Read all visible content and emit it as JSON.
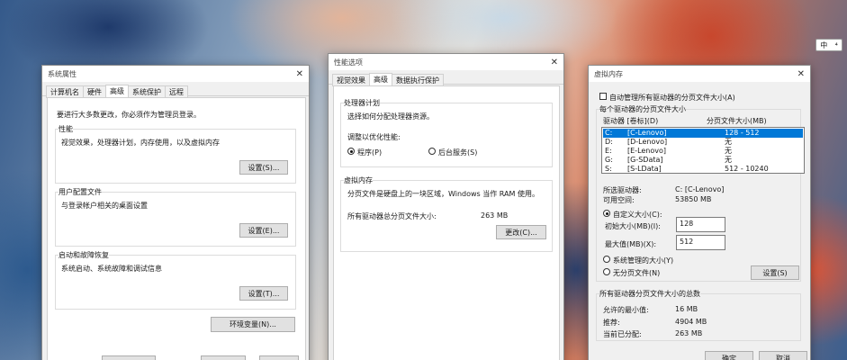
{
  "ime": {
    "mode": "中",
    "extra": "⁴"
  },
  "sys_props": {
    "title": "系统属性",
    "tabs": [
      "计算机名",
      "硬件",
      "高级",
      "系统保护",
      "远程"
    ],
    "admin_note": "要进行大多数更改，你必须作为管理员登录。",
    "perf": {
      "label": "性能",
      "desc": "视觉效果，处理器计划，内存使用，以及虚拟内存",
      "button": "设置(S)..."
    },
    "profile": {
      "label": "用户配置文件",
      "desc": "与登录帐户相关的桌面设置",
      "button": "设置(E)..."
    },
    "startup": {
      "label": "启动和故障恢复",
      "desc": "系统启动、系统故障和调试信息",
      "button": "设置(T)..."
    },
    "env_button": "环境变量(N)..."
  },
  "perf_opts": {
    "title": "性能选项",
    "tabs": [
      "视觉效果",
      "高级",
      "数据执行保护"
    ],
    "sched": {
      "label": "处理器计划",
      "desc": "选择如何分配处理器资源。",
      "adjust": "调整以优化性能:",
      "opt_programs": "程序(P)",
      "opt_services": "后台服务(S)"
    },
    "vmem": {
      "label": "虚拟内存",
      "desc": "分页文件是硬盘上的一块区域，Windows 当作 RAM 使用。",
      "total_label": "所有驱动器总分页文件大小:",
      "total_value": "263 MB",
      "button": "更改(C)..."
    }
  },
  "vm": {
    "title": "虚拟内存",
    "auto_manage": "自动管理所有驱动器的分页文件大小(A)",
    "per_drive_label": "每个驱动器的分页文件大小",
    "col_drive": "驱动器 [卷标](D)",
    "col_size": "分页文件大小(MB)",
    "drives": [
      {
        "letter": "C:",
        "label": "[C-Lenovo]",
        "size": "128 - 512"
      },
      {
        "letter": "D:",
        "label": "[D-Lenovo]",
        "size": "无"
      },
      {
        "letter": "E:",
        "label": "[E-Lenovo]",
        "size": "无"
      },
      {
        "letter": "G:",
        "label": "[G-SData]",
        "size": "无"
      },
      {
        "letter": "S:",
        "label": "[S-LData]",
        "size": "512 - 10240"
      }
    ],
    "selected_drive_label": "所选驱动器:",
    "selected_drive_value": "C:  [C-Lenovo]",
    "free_space_label": "可用空间:",
    "free_space_value": "53850 MB",
    "custom_size": "自定义大小(C):",
    "initial_label": "初始大小(MB)(I):",
    "initial_value": "128",
    "max_label": "最大值(MB)(X):",
    "max_value": "512",
    "system_managed": "系统管理的大小(Y)",
    "no_paging": "无分页文件(N)",
    "set_button": "设置(S)",
    "total_group": "所有驱动器分页文件大小的总数",
    "min_allowed_label": "允许的最小值:",
    "min_allowed_value": "16 MB",
    "recommended_label": "推荐:",
    "recommended_value": "4904 MB",
    "allocated_label": "当前已分配:",
    "allocated_value": "263 MB",
    "ok_button": "确定",
    "cancel_button": "取消"
  }
}
